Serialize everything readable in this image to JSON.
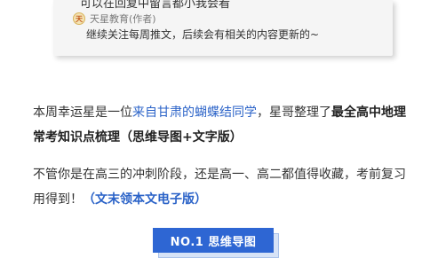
{
  "comment_card": {
    "top_text": "可以在回复中留言都小我会看",
    "reply": {
      "avatar_char": "天",
      "author": "天星教育(作者)",
      "text": "继续关注每周推文，后续会有相关的内容更新的~"
    }
  },
  "article": {
    "p1": {
      "part1": "本周幸运星是一位",
      "link": "来自甘肃的蝴蝶结同学",
      "part2": "，星哥整理了",
      "bold": "最全高中地理常考知识点梳理（思维导图+文字版）"
    },
    "p2": {
      "part1": "不管你是在高三的冲刺阶段，还是高一、高二都值得收藏，考前复习用得到！",
      "link": "（文末领本文电子版）"
    },
    "badge": "NO.1 思维导图"
  },
  "colors": {
    "link": "#2b63c8",
    "badge_bg": "#2e66d3"
  }
}
